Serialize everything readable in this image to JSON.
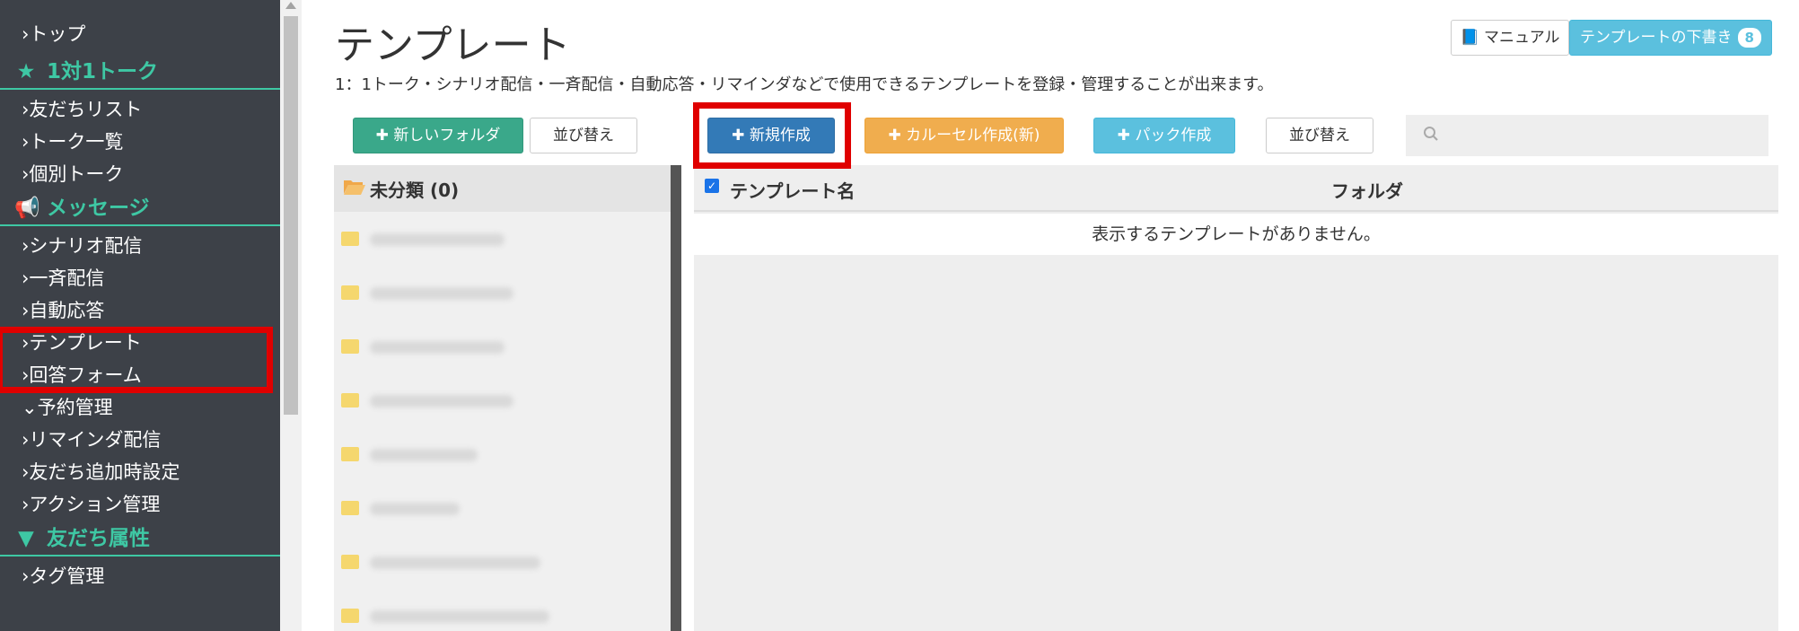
{
  "sidebar": {
    "items": [
      {
        "type": "item",
        "label": "›トップ"
      },
      {
        "type": "head",
        "icon": "star-icon",
        "label": "1対1トーク"
      },
      {
        "type": "item",
        "label": "›友だちリスト"
      },
      {
        "type": "item",
        "label": "›トーク一覧"
      },
      {
        "type": "item",
        "label": "›個別トーク"
      },
      {
        "type": "head",
        "icon": "megaphone-icon",
        "label": "メッセージ"
      },
      {
        "type": "item",
        "label": "›シナリオ配信"
      },
      {
        "type": "item",
        "label": "›一斉配信"
      },
      {
        "type": "item",
        "label": "›自動応答"
      },
      {
        "type": "item",
        "label": "›テンプレート"
      },
      {
        "type": "item",
        "label": "›回答フォーム"
      },
      {
        "type": "item",
        "label": "⌄予約管理"
      },
      {
        "type": "item",
        "label": "›リマインダ配信"
      },
      {
        "type": "item",
        "label": "›友だち追加時設定"
      },
      {
        "type": "item",
        "label": "›アクション管理"
      },
      {
        "type": "head",
        "icon": "filter-icon",
        "label": "友だち属性"
      },
      {
        "type": "item",
        "label": "›タグ管理"
      }
    ]
  },
  "header": {
    "title": "テンプレート",
    "description": "1：1トーク・シナリオ配信・一斉配信・自動応答・リマインダなどで使用できるテンプレートを登録・管理することが出来ます。",
    "manual_label": "📘 マニュアル",
    "drafts_label": "テンプレートの下書き",
    "drafts_count": "8"
  },
  "toolbar": {
    "new_folder": "✚ 新しいフォルダ",
    "sort_left": "並び替え",
    "new": "✚ 新規作成",
    "carousel": "✚ カルーセル作成(新)",
    "pack": "✚ パック作成",
    "sort_right": "並び替え",
    "search_placeholder": ""
  },
  "folders": {
    "head_label": "未分類 (0)"
  },
  "table": {
    "col_name": "テンプレート名",
    "col_folder": "フォルダ",
    "empty_message": "表示するテンプレートがありません。"
  },
  "colors": {
    "sidebar_bg": "#3d4148",
    "accent_green": "#3ec8a4",
    "primary_blue": "#337ab7",
    "highlight_red": "#e00000"
  }
}
